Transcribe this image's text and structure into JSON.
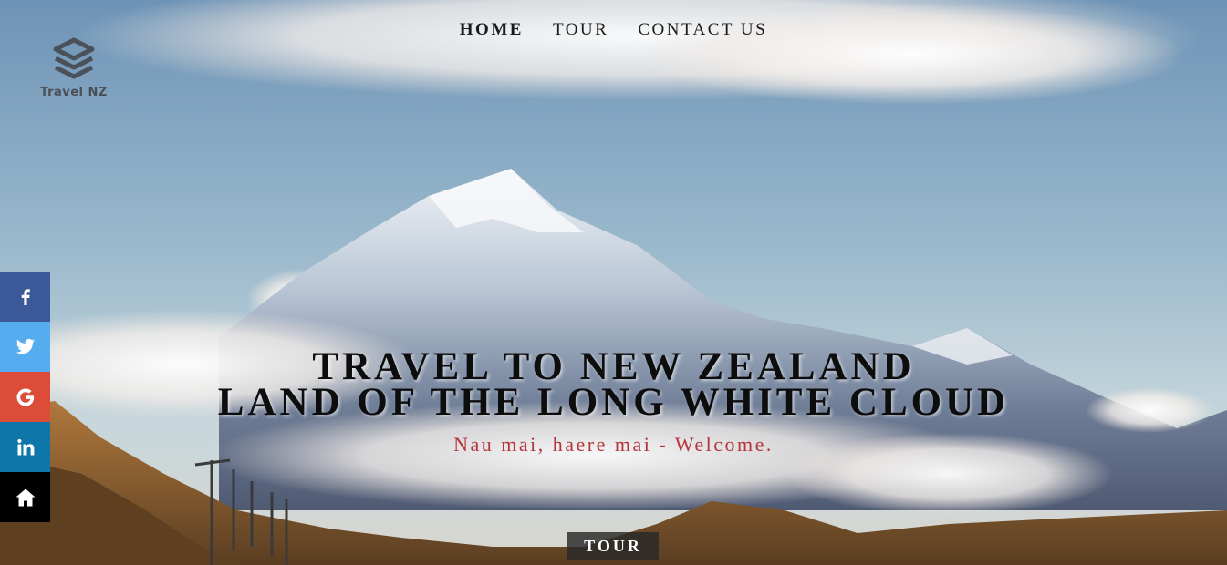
{
  "brand": {
    "name": "Travel NZ",
    "icon": "stacked-cube-logo-icon"
  },
  "nav": {
    "items": [
      {
        "label": "HOME",
        "active": true
      },
      {
        "label": "TOUR",
        "active": false
      },
      {
        "label": "CONTACT US",
        "active": false
      }
    ]
  },
  "social": {
    "items": [
      {
        "icon": "facebook-icon",
        "color": "#3b5998"
      },
      {
        "icon": "twitter-icon",
        "color": "#55acee"
      },
      {
        "icon": "google-icon",
        "color": "#dd4b39"
      },
      {
        "icon": "linkedin-icon",
        "color": "#0e76a8"
      },
      {
        "icon": "home-icon",
        "color": "#000000"
      }
    ]
  },
  "hero": {
    "title_line1": "TRAVEL TO NEW ZEALAND",
    "title_line2": "LAND OF THE LONG WHITE CLOUD",
    "subtitle": "Nau mai, haere mai - Welcome.",
    "cta_label": "TOUR",
    "subtitle_color": "#b5343a"
  }
}
